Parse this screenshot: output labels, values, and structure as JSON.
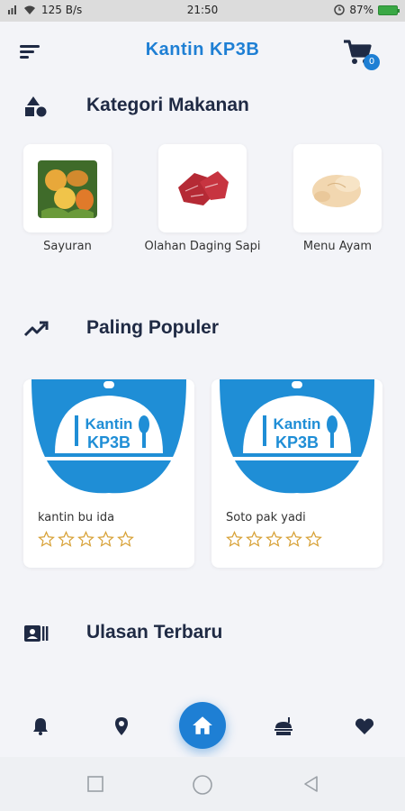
{
  "status_bar": {
    "speed": "125 B/s",
    "time": "21:50",
    "battery": "87%"
  },
  "header": {
    "title": "Kantin KP3B",
    "cart_count": "0"
  },
  "categories": {
    "title": "Kategori Makanan",
    "items": [
      {
        "label": "Sayuran"
      },
      {
        "label": "Olahan Daging Sapi"
      },
      {
        "label": "Menu Ayam"
      }
    ]
  },
  "popular": {
    "title": "Paling Populer",
    "logo_text_1": "Kantin",
    "logo_text_2": "KP3B",
    "items": [
      {
        "name": "kantin bu ida",
        "rating": 0,
        "max_rating": 5
      },
      {
        "name": "Soto pak yadi",
        "rating": 0,
        "max_rating": 5
      }
    ]
  },
  "reviews": {
    "title": "Ulasan Terbaru"
  },
  "colors": {
    "accent": "#1e7fd4",
    "star": "#d8a33a",
    "text_dark": "#1f2a44"
  },
  "nav": {
    "items": [
      "bell-icon",
      "location-pin-icon",
      "home-icon",
      "restaurant-icon",
      "heart-icon"
    ]
  }
}
